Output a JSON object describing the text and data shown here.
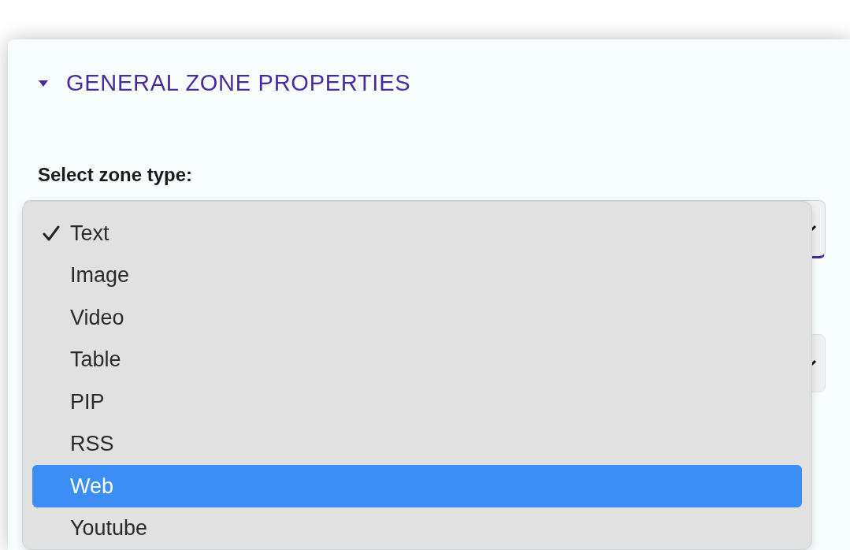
{
  "section": {
    "title": "GENERAL ZONE PROPERTIES",
    "expanded": true
  },
  "zone_type": {
    "label": "Select zone type:"
  },
  "dropdown": {
    "options": [
      {
        "label": "Text",
        "checked": true,
        "selected": false
      },
      {
        "label": "Image",
        "checked": false,
        "selected": false
      },
      {
        "label": "Video",
        "checked": false,
        "selected": false
      },
      {
        "label": "Table",
        "checked": false,
        "selected": false
      },
      {
        "label": "PIP",
        "checked": false,
        "selected": false
      },
      {
        "label": "RSS",
        "checked": false,
        "selected": false
      },
      {
        "label": "Web",
        "checked": false,
        "selected": true
      },
      {
        "label": "Youtube",
        "checked": false,
        "selected": false
      }
    ]
  }
}
